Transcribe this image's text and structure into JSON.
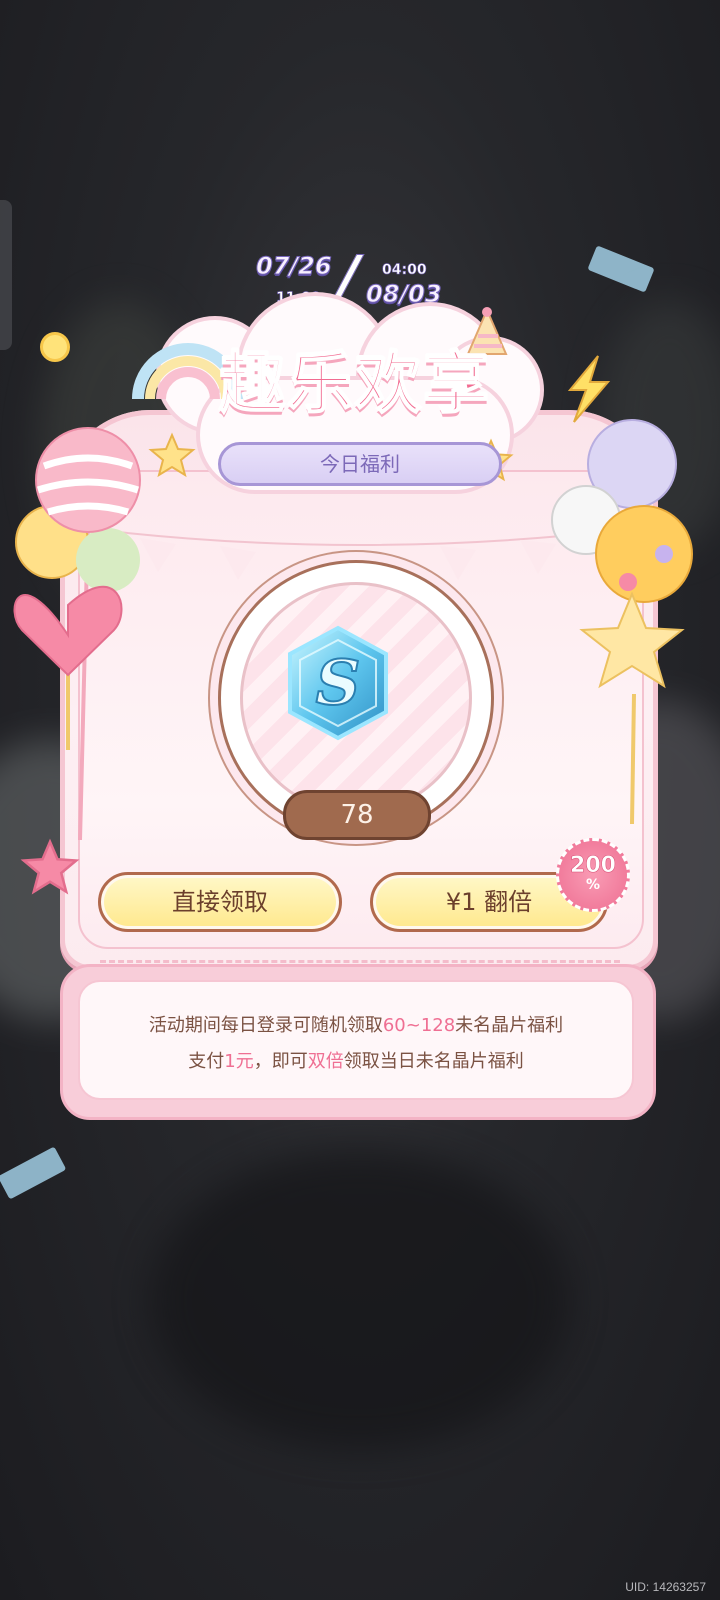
{
  "event": {
    "start_date": "07/26",
    "start_time": "11:00",
    "end_date": "08/03",
    "end_time": "04:00",
    "title": "趣乐欢享",
    "subtitle": "今日福利"
  },
  "reward": {
    "icon": "crystal-shard-icon",
    "glyph": "S",
    "count": "78"
  },
  "buttons": {
    "claim_label": "直接领取",
    "double_label": "¥1  翻倍"
  },
  "badge": {
    "value": "200",
    "symbol": "%"
  },
  "info": {
    "line1_pre": "活动期间每日登录可随机领取",
    "line1_range": "60~128",
    "line1_post": "未名晶片福利",
    "line2_pre": "支付",
    "line2_price": "1元",
    "line2_mid": "，即可",
    "line2_double": "双倍",
    "line2_post": "领取当日未名晶片福利"
  },
  "footer": {
    "uid": "UID: 14263257"
  },
  "colors": {
    "accent_pink": "#f26c92",
    "brown": "#a06a4e",
    "lavender": "#7c69b8",
    "button_yellow": "#ffe88c"
  }
}
